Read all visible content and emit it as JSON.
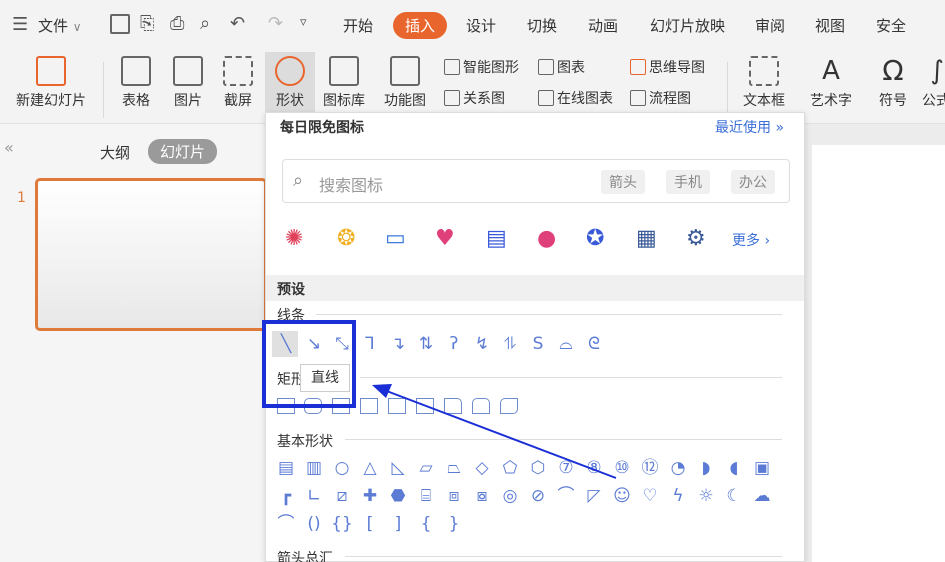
{
  "menu": {
    "hamburger_label": "文件"
  },
  "tabs": [
    "开始",
    "插入",
    "设计",
    "切换",
    "动画",
    "幻灯片放映",
    "审阅",
    "视图",
    "安全"
  ],
  "active_tab": "插入",
  "ribbon": {
    "new_slide": "新建幻灯片",
    "table": "表格",
    "picture": "图片",
    "screenshot": "截屏",
    "shape": "形状",
    "icon_lib": "图标库",
    "func_chart": "功能图",
    "smart_graphic": "智能图形",
    "chart": "图表",
    "mind_map": "思维导图",
    "relation_chart": "关系图",
    "online_chart": "在线图表",
    "flowchart": "流程图",
    "textbox": "文本框",
    "art_text": "艺术字",
    "symbol": "符号",
    "formula": "公式"
  },
  "left_pane": {
    "outline": "大纲",
    "slides": "幻灯片",
    "slide_number": "1"
  },
  "dropdown": {
    "header": "每日限免图标",
    "recent": "最近使用",
    "search_placeholder": "搜索图标",
    "chips": [
      "箭头",
      "手机",
      "办公"
    ],
    "more": "更多",
    "preset": "预设",
    "lines": "线条",
    "rect": "矩形",
    "basic": "基本形状",
    "arrows": "箭头总汇"
  },
  "tooltip": "直线",
  "colors": {
    "accent": "#e8662e",
    "highlight": "#1a2fd6",
    "shape": "#5b7bd5"
  }
}
